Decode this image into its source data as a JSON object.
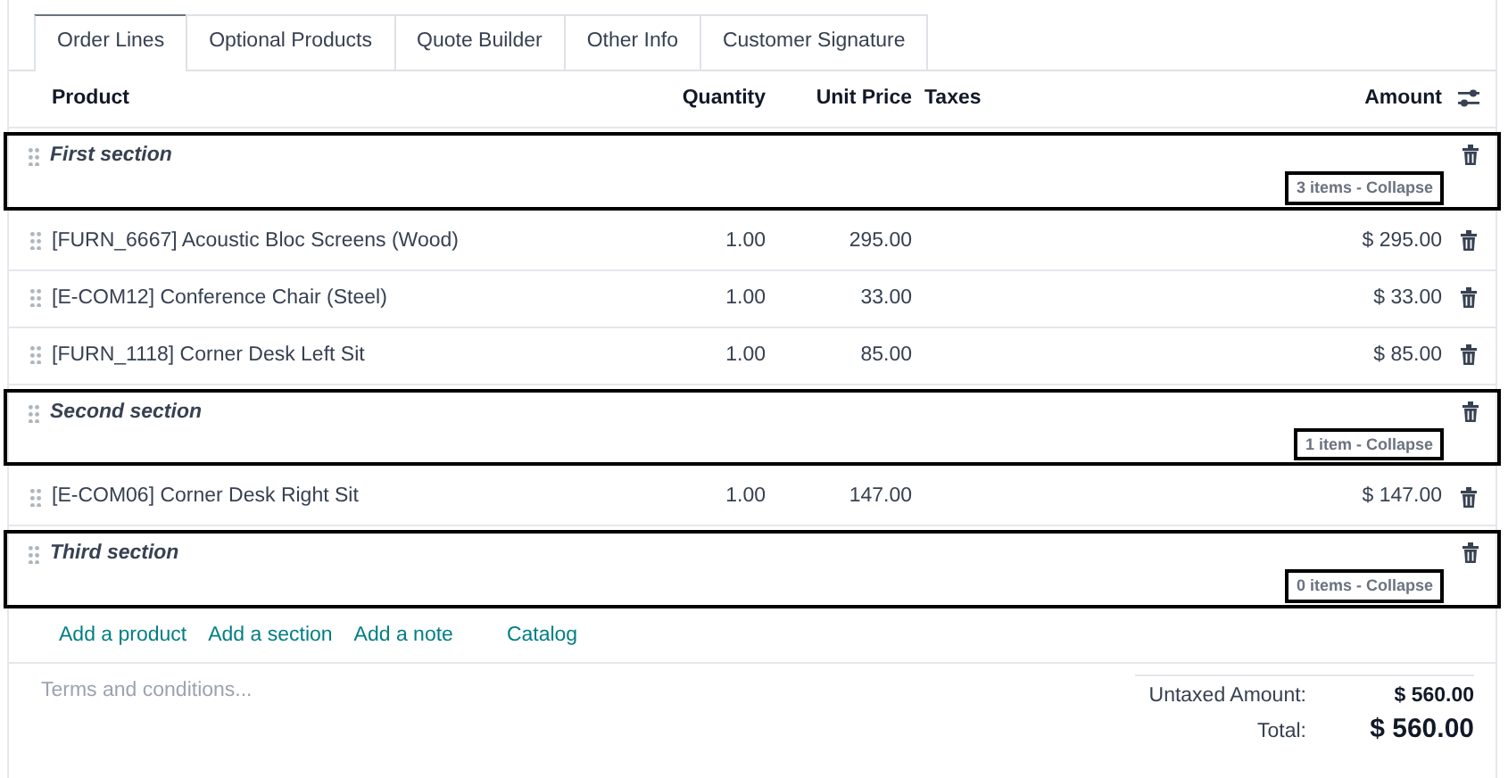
{
  "tabs": [
    {
      "label": "Order Lines",
      "selected": true
    },
    {
      "label": "Optional Products",
      "selected": false
    },
    {
      "label": "Quote Builder",
      "selected": false
    },
    {
      "label": "Other Info",
      "selected": false
    },
    {
      "label": "Customer Signature",
      "selected": false
    }
  ],
  "table": {
    "columns": [
      "Product",
      "Quantity",
      "Unit Price",
      "Taxes",
      "Amount"
    ],
    "rows": [
      {
        "kind": "section",
        "title": "First section",
        "summary": "3 items - Collapse",
        "highlighted": true
      },
      {
        "kind": "line",
        "product": "[FURN_6667] Acoustic Bloc Screens (Wood)",
        "quantity": "1.00",
        "unit_price": "295.00",
        "amount": "$ 295.00"
      },
      {
        "kind": "line",
        "product": "[E-COM12] Conference Chair (Steel)",
        "quantity": "1.00",
        "unit_price": "33.00",
        "amount": "$ 33.00"
      },
      {
        "kind": "line",
        "product": "[FURN_1118] Corner Desk Left Sit",
        "quantity": "1.00",
        "unit_price": "85.00",
        "amount": "$ 85.00"
      },
      {
        "kind": "section",
        "title": "Second section",
        "summary": "1 item - Collapse",
        "highlighted": true
      },
      {
        "kind": "line",
        "product": "[E-COM06] Corner Desk Right Sit",
        "quantity": "1.00",
        "unit_price": "147.00",
        "amount": "$ 147.00"
      },
      {
        "kind": "section",
        "title": "Third section",
        "summary": "0 items - Collapse",
        "highlighted": true
      }
    ]
  },
  "actions": [
    "Add a product",
    "Add a section",
    "Add a note",
    "Catalog"
  ],
  "terms": {
    "placeholder": "Terms and conditions..."
  },
  "totals": [
    {
      "label": "Untaxed Amount:",
      "value": "$ 560.00",
      "kind": "subtotal"
    },
    {
      "label": "Total:",
      "value": "$ 560.00",
      "kind": "total"
    }
  ]
}
